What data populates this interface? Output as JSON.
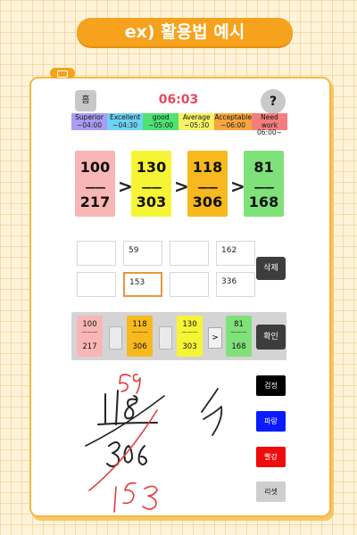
{
  "banner": {
    "title": "ex) 활용법 예시"
  },
  "header": {
    "home_label": "홈",
    "timer": "06:03",
    "help_label": "?"
  },
  "grades": [
    {
      "name": "Superior",
      "time": "~04:00",
      "color": "#a99cf4"
    },
    {
      "name": "Excellent",
      "time": "~04:30",
      "color": "#6ed2f4"
    },
    {
      "name": "good",
      "time": "~05:00",
      "color": "#4de371"
    },
    {
      "name": "Average",
      "time": "~05:30",
      "color": "#f7f266"
    },
    {
      "name": "Acceptable",
      "time": "~06:00",
      "color": "#f7a63f"
    },
    {
      "name": "Need work",
      "time": "06:00~",
      "color": "#f47e7e"
    }
  ],
  "comparison": {
    "fractions": [
      {
        "num": "100",
        "den": "217",
        "color": "#f9b6b6"
      },
      {
        "num": "130",
        "den": "303",
        "color": "#f6f535"
      },
      {
        "num": "118",
        "den": "306",
        "color": "#f7b91d"
      },
      {
        "num": "81",
        "den": "168",
        "color": "#7fe17a"
      }
    ],
    "line": "——",
    "symbol": ">"
  },
  "grid": {
    "row1": [
      "",
      "59",
      "",
      "162"
    ],
    "row2": [
      "",
      "153",
      "",
      "336"
    ],
    "delete_label": "삭제"
  },
  "strip": {
    "cards": [
      {
        "num": "100",
        "den": "217",
        "color": "#f9b6b6"
      },
      {
        "num": "118",
        "den": "306",
        "color": "#f7b91d"
      },
      {
        "num": "130",
        "den": "303",
        "color": "#f6f535"
      },
      {
        "num": "81",
        "den": "168",
        "color": "#7fe17a"
      }
    ],
    "line": "———",
    "arrow": ">",
    "confirm_label": "확인"
  },
  "pens": {
    "black_label": "검정",
    "blue_label": "파랑",
    "red_label": "빨강",
    "reset_label": "리셋"
  },
  "handwriting": {
    "num_top": "118",
    "scratch_top": "59",
    "den": "306",
    "red": "153"
  }
}
